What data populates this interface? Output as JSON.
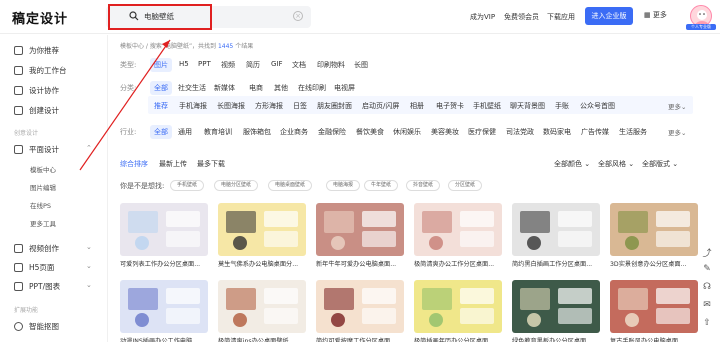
{
  "app": {
    "logo": "稿定设计"
  },
  "search": {
    "query": "电脑壁纸",
    "clear_icon": "close-circle-icon"
  },
  "header_nav": [
    {
      "label": "成为VIP"
    },
    {
      "label": "免费领会员"
    },
    {
      "label": "下载应用"
    }
  ],
  "header": {
    "enterprise_label": "进入企业版",
    "more_label": "更多",
    "avatar_tag": "个人专业版"
  },
  "sidebar": {
    "items": [
      {
        "label": "为你推荐"
      },
      {
        "label": "我的工作台"
      },
      {
        "label": "设计协作"
      },
      {
        "label": "创建设计"
      }
    ],
    "section_create": "创意设计",
    "flat_design": "平面设计",
    "sub_items": [
      {
        "label": "模板中心"
      },
      {
        "label": "图片编辑"
      },
      {
        "label": "在线PS"
      },
      {
        "label": "更多工具"
      }
    ],
    "video": "视频创作",
    "h5": "H5页面",
    "ppt": "PPT/图表",
    "section_expand": "扩展功能",
    "smart": "智能抠图"
  },
  "breadcrumb": {
    "prefix": "模板中心 / 搜索“电脑壁纸”，共找到",
    "count": "1445",
    "suffix": "个结果"
  },
  "filters": {
    "type_label": "类型:",
    "types": [
      "图片",
      "H5",
      "PPT",
      "视频",
      "简历",
      "GIF",
      "文档",
      "印刷物料",
      "长图"
    ],
    "category_label": "分类:",
    "categories": [
      "全部",
      "社交生活",
      "新媒体",
      "电商",
      "其他",
      "在线印刷",
      "电视屏"
    ],
    "sub_categories": [
      "推荐",
      "手机海报",
      "长图海报",
      "方形海报",
      "日签",
      "朋友圈封面",
      "启动页/闪屏",
      "相册",
      "电子贺卡",
      "手机壁纸",
      "聊天背景图",
      "手账",
      "公众号首图"
    ],
    "industry_label": "行业:",
    "industries": [
      "全部",
      "通用",
      "教育培训",
      "服饰箱包",
      "企业商务",
      "金融保险",
      "餐饮美食",
      "休闲娱乐",
      "美容美妆",
      "医疗保健",
      "司法党政",
      "数码家电",
      "广告传媒",
      "生活服务"
    ],
    "more": "更多"
  },
  "sort": {
    "options": [
      "综合排序",
      "最新上传",
      "最多下载"
    ],
    "color": "全部颜色",
    "style": "全部风格",
    "layout": "全部版式"
  },
  "suggest": {
    "label": "你是不是想找:",
    "tags": [
      "手机壁纸",
      "电脑分区壁纸",
      "电脑桌面壁纸",
      "电脑海报",
      "牛年壁纸",
      "抖音壁纸",
      "分区壁纸"
    ]
  },
  "cards_row1": [
    {
      "title": "可爱列表工作办公分区桌面...",
      "bg": "#e9e6ee",
      "accent": "#b9d3f0"
    },
    {
      "title": "莫生气佛系办公电脑桌面分...",
      "bg": "#f6e7a6",
      "accent": "#333333"
    },
    {
      "title": "新年牛年可爱办公电脑桌面...",
      "bg": "#c98f85",
      "accent": "#ecd3c5"
    },
    {
      "title": "极简清爽办公工作分区桌面...",
      "bg": "#f3dfd9",
      "accent": "#c77d74"
    },
    {
      "title": "简约黑白插画工作分区桌面...",
      "bg": "#e4e4e4",
      "accent": "#333333"
    },
    {
      "title": "3D实景创意办公分区桌面...",
      "bg": "#d9b894",
      "accent": "#7b8e3e"
    }
  ],
  "cards_row2": [
    {
      "title": "动漫INS插画办公工作电脑...",
      "bg": "#dde3f5",
      "accent": "#6877c9"
    },
    {
      "title": "极简清爽ins办公桌面壁纸...",
      "bg": "#f2ece4",
      "accent": "#b05b3b"
    },
    {
      "title": "简约可爱按摩工作分区桌面...",
      "bg": "#f5e1cf",
      "accent": "#7a2020"
    },
    {
      "title": "极简插画年历办公分区桌面...",
      "bg": "#f0e78a",
      "accent": "#8fbf6a"
    },
    {
      "title": "绿色教育黑板办公分区桌面...",
      "bg": "#3e5a49",
      "accent": "#e9e1c0"
    },
    {
      "title": "复古手账风办公电脑桌面...",
      "bg": "#c46b5d",
      "accent": "#f1e3d0"
    }
  ]
}
